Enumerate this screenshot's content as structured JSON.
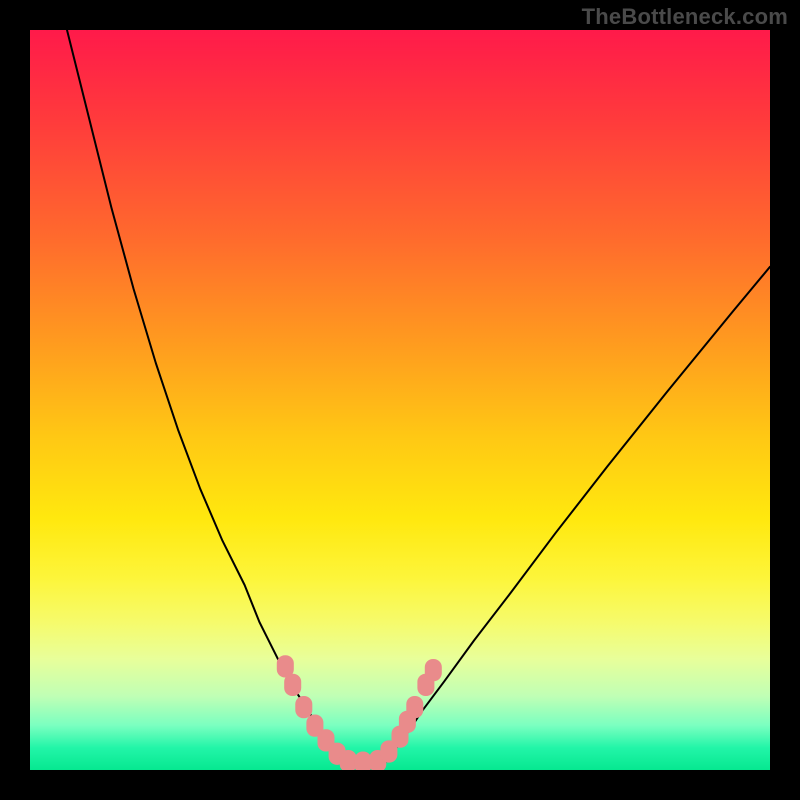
{
  "watermark": "TheBottleneck.com",
  "chart_data": {
    "type": "line",
    "title": "",
    "xlabel": "",
    "ylabel": "",
    "xlim": [
      0,
      100
    ],
    "ylim": [
      0,
      100
    ],
    "grid": false,
    "legend": false,
    "note": "Underlying data unlabeled; values are normalized curve pixel positions read from the figure, origin at top-left of the colored plot area (0–100 each axis).",
    "series": [
      {
        "name": "left-curve",
        "x": [
          5,
          8,
          11,
          14,
          17,
          20,
          23,
          26,
          29,
          31,
          33,
          35,
          37,
          38.5,
          40,
          41,
          42
        ],
        "y": [
          0,
          12,
          24,
          35,
          45,
          54,
          62,
          69,
          75,
          80,
          84,
          88,
          91,
          93.5,
          96,
          97.5,
          99
        ]
      },
      {
        "name": "right-curve",
        "x": [
          48,
          49.5,
          51,
          53,
          56,
          60,
          65,
          71,
          78,
          86,
          95,
          100
        ],
        "y": [
          99,
          97,
          95,
          92,
          88,
          82.5,
          76,
          68,
          59,
          49,
          38,
          32
        ]
      },
      {
        "name": "markers-left",
        "style": "pink-rounded-rect",
        "points": [
          {
            "x": 34.5,
            "y": 86
          },
          {
            "x": 35.5,
            "y": 88.5
          },
          {
            "x": 37.0,
            "y": 91.5
          },
          {
            "x": 38.5,
            "y": 94
          },
          {
            "x": 40.0,
            "y": 96
          },
          {
            "x": 41.5,
            "y": 97.8
          }
        ]
      },
      {
        "name": "markers-bottom",
        "style": "pink-rounded-rect",
        "points": [
          {
            "x": 43.0,
            "y": 98.8
          },
          {
            "x": 45.0,
            "y": 99.0
          },
          {
            "x": 47.0,
            "y": 98.8
          }
        ]
      },
      {
        "name": "markers-right",
        "style": "pink-rounded-rect",
        "points": [
          {
            "x": 48.5,
            "y": 97.5
          },
          {
            "x": 50.0,
            "y": 95.5
          },
          {
            "x": 51.0,
            "y": 93.5
          },
          {
            "x": 52.0,
            "y": 91.5
          },
          {
            "x": 53.5,
            "y": 88.5
          },
          {
            "x": 54.5,
            "y": 86.5
          }
        ]
      }
    ],
    "colors": {
      "curve_stroke": "#000000",
      "marker_fill": "#e98b8b",
      "gradient_top": "#ff1a4a",
      "gradient_bottom": "#06e890"
    }
  }
}
